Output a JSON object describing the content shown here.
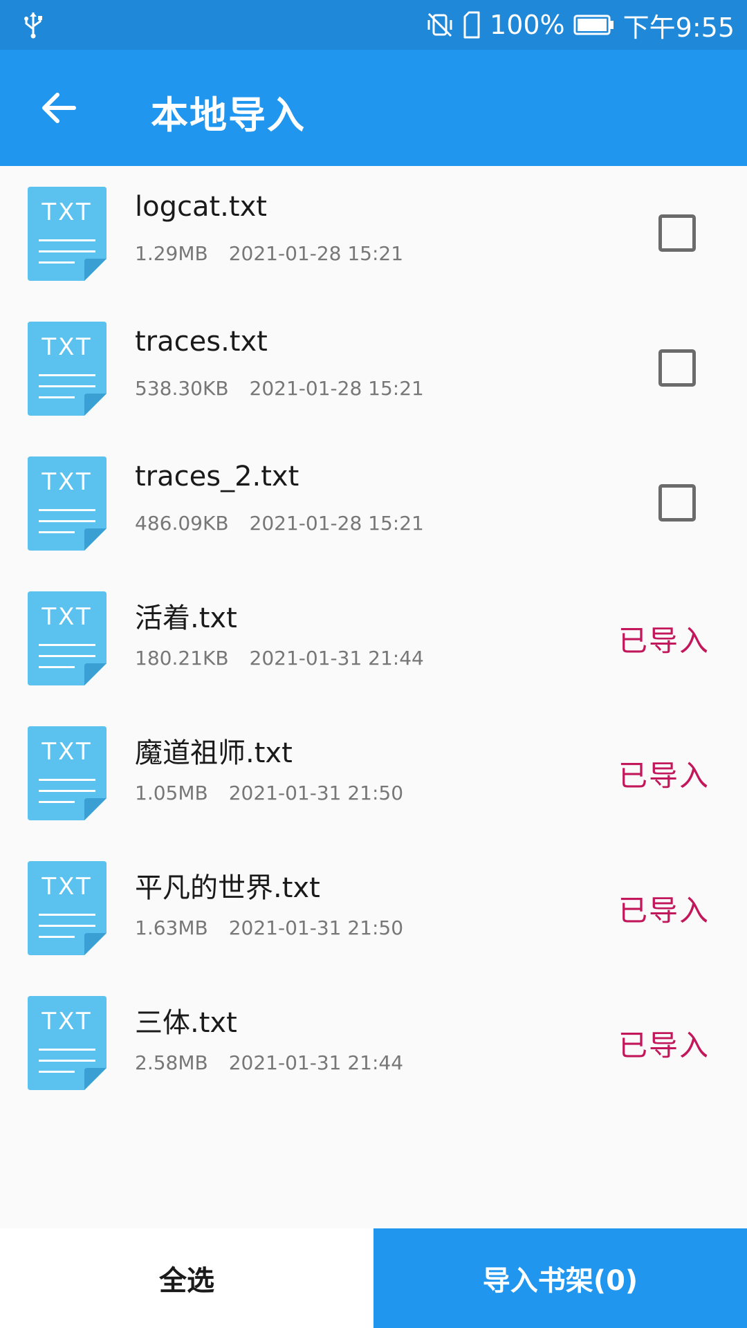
{
  "status_bar": {
    "battery_percent": "100%",
    "time": "下午9:55",
    "icons": [
      "usb-icon",
      "vibrate-off-icon",
      "sim-card-icon",
      "battery-icon"
    ]
  },
  "app_bar": {
    "title": "本地导入",
    "back_icon": "arrow-left-icon"
  },
  "colors": {
    "status_bar": "#1f88d8",
    "app_bar": "#2196ee",
    "file_icon": "#5bc1ef",
    "imported_text": "#c2185b",
    "import_button": "#2196ee"
  },
  "file_icon_label": "TXT",
  "files": [
    {
      "name": "logcat.txt",
      "size": "1.29MB",
      "date": "2021-01-28 15:21",
      "imported": false,
      "checked": false
    },
    {
      "name": "traces.txt",
      "size": "538.30KB",
      "date": "2021-01-28 15:21",
      "imported": false,
      "checked": false
    },
    {
      "name": "traces_2.txt",
      "size": "486.09KB",
      "date": "2021-01-28 15:21",
      "imported": false,
      "checked": false
    },
    {
      "name": "活着.txt",
      "size": "180.21KB",
      "date": "2021-01-31 21:44",
      "imported": true,
      "status": "已导入"
    },
    {
      "name": "魔道祖师.txt",
      "size": "1.05MB",
      "date": "2021-01-31 21:50",
      "imported": true,
      "status": "已导入"
    },
    {
      "name": "平凡的世界.txt",
      "size": "1.63MB",
      "date": "2021-01-31 21:50",
      "imported": true,
      "status": "已导入"
    },
    {
      "name": "三体.txt",
      "size": "2.58MB",
      "date": "2021-01-31 21:44",
      "imported": true,
      "status": "已导入"
    }
  ],
  "bottom_bar": {
    "select_all_label": "全选",
    "import_label": "导入书架(0)"
  }
}
